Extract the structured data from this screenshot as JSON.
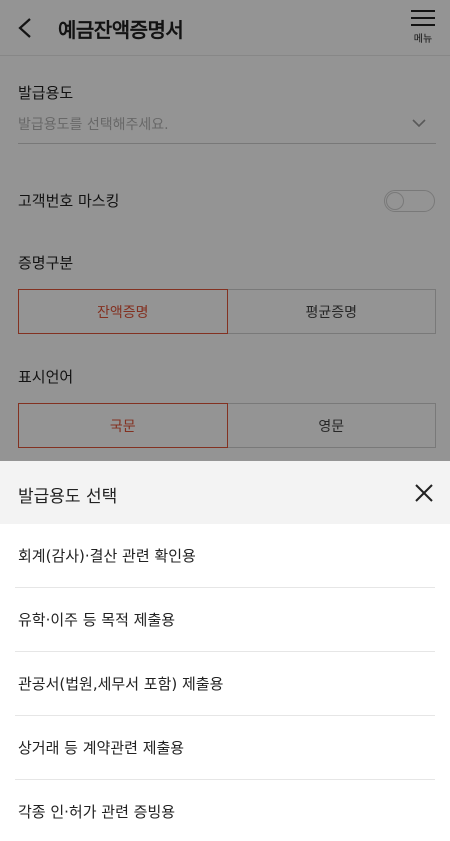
{
  "header": {
    "title": "예금잔액증명서",
    "menu_label": "메뉴",
    "back_icon": "chevron-left-icon",
    "menu_icon": "hamburger-icon"
  },
  "form": {
    "purpose": {
      "label": "발급용도",
      "placeholder": "발급용도를 선택해주세요."
    },
    "masking": {
      "label": "고객번호 마스킹",
      "enabled": false
    },
    "certificate_type": {
      "label": "증명구분",
      "options": [
        "잔액증명",
        "평균증명"
      ],
      "selected": "잔액증명"
    },
    "language": {
      "label": "표시언어",
      "options": [
        "국문",
        "영문"
      ],
      "selected": "국문"
    }
  },
  "sheet": {
    "title": "발급용도 선택",
    "options": [
      "회계(감사)·결산 관련 확인용",
      "유학·이주 등 목적 제출용",
      "관공서(법원,세무서 포함) 제출용",
      "상거래 등 계약관련 제출용",
      "각종 인·허가 관련 증빙용"
    ]
  },
  "colors": {
    "accent": "#e2553a",
    "overlay": "rgba(0,0,0,0.42)",
    "sheet_header_bg": "#f3f3f3"
  }
}
